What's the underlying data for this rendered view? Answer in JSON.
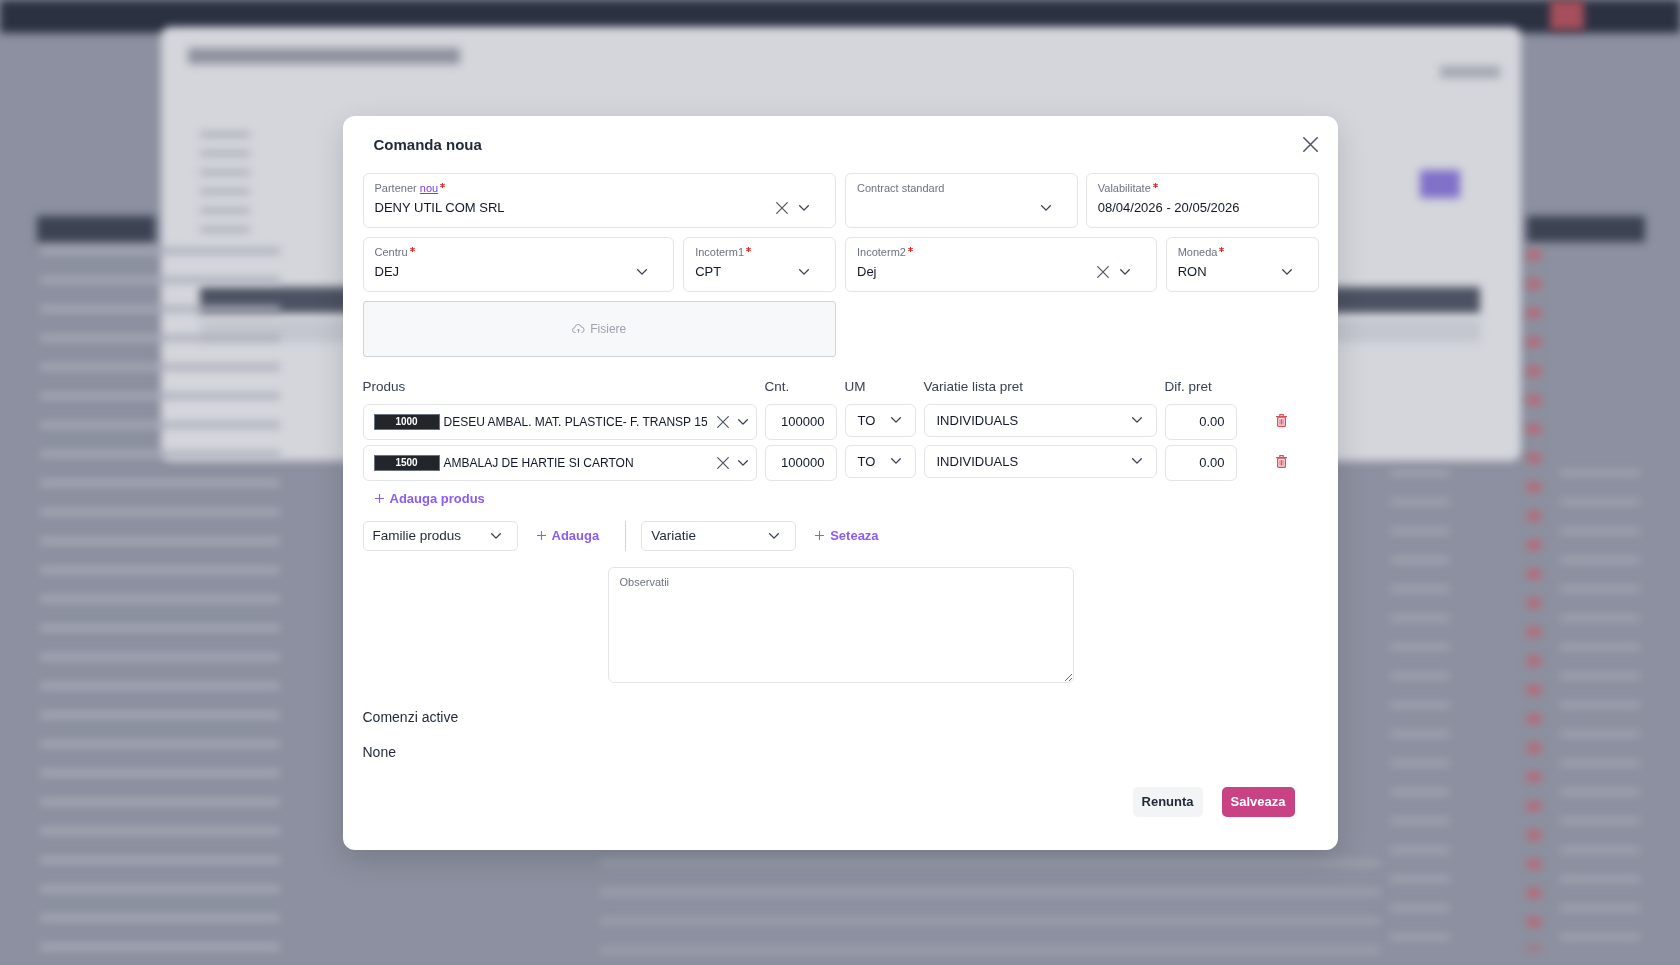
{
  "dialog": {
    "title": "Comanda noua",
    "fields": [
      {
        "kind": "select",
        "label": "Partener",
        "link": "nou",
        "required": true,
        "value": "DENY UTIL COM SRL",
        "clearable": true
      },
      {
        "kind": "select",
        "label": "Contract standard",
        "required": false,
        "clearable": false
      },
      {
        "kind": "date_range",
        "label": "Valabilitate",
        "required": true,
        "value": "08/04/2026 - 20/05/2026"
      },
      {
        "kind": "select",
        "label": "Centru",
        "required": true,
        "value": "DEJ",
        "clearable": false
      },
      {
        "kind": "select",
        "label": "Incoterm1",
        "required": true,
        "value": "CPT",
        "clearable": false
      },
      {
        "kind": "select",
        "label": "Incoterm2",
        "required": true,
        "value": "Dej",
        "clearable": true
      },
      {
        "kind": "select",
        "label": "Moneda",
        "required": true,
        "value": "RON",
        "clearable": false
      }
    ],
    "upload": {
      "label": "Fisiere"
    },
    "products": {
      "columns": [
        "Produs",
        "Cnt.",
        "UM",
        "Variatie lista pret",
        "Dif. pret"
      ],
      "rows": [
        {
          "code": "1000",
          "name": "DESEU AMBAL. MAT. PLASTICE- F. TRANSP 15",
          "quantity": "100000",
          "unit": "TO",
          "price_list_variation": "INDIVIDUALS",
          "price_difference": "0.00"
        },
        {
          "code": "1500",
          "name": "AMBALAJ DE HARTIE SI CARTON",
          "quantity": "100000",
          "unit": "TO",
          "price_list_variation": "INDIVIDUALS",
          "price_difference": "0.00"
        }
      ],
      "add_label": "Adauga produs"
    },
    "family_filter": {
      "placeholder": "Familie produs",
      "action": "Adauga"
    },
    "variation_filter": {
      "placeholder": "Variatie",
      "action": "Seteaza"
    },
    "notes": {
      "placeholder": "Observatii"
    },
    "active_orders": {
      "heading": "Comenzi active",
      "value": "None"
    },
    "buttons": [
      {
        "kind": "secondary",
        "label": "Renunta"
      },
      {
        "kind": "primary",
        "label": "Salveaza"
      }
    ]
  }
}
